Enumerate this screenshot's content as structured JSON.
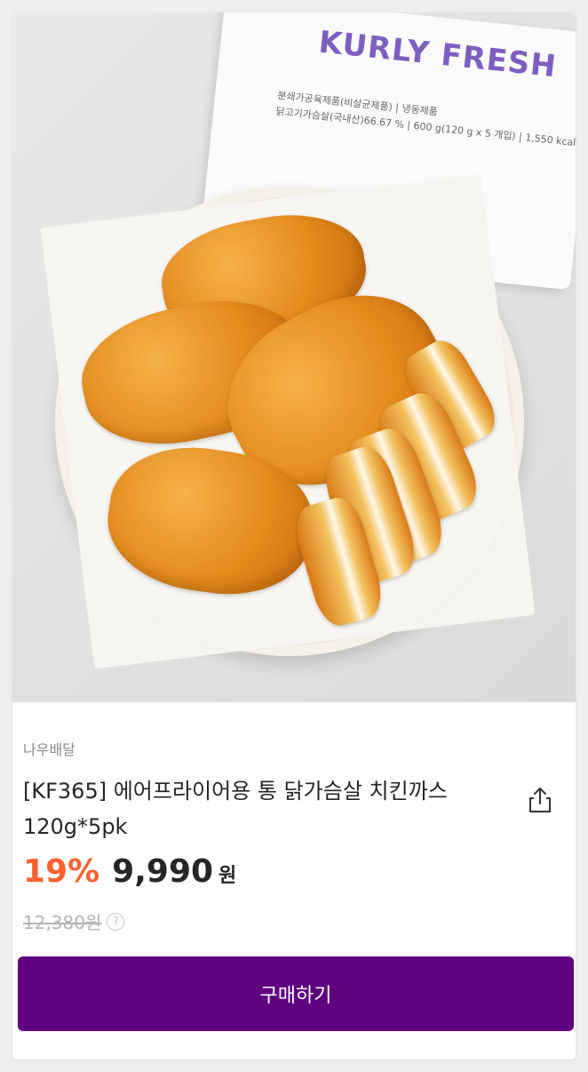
{
  "product": {
    "image": {
      "package_brand": "KURLY FRESH",
      "package_info_line1": "분쇄가공육제품(비살균제품) | 냉동제품",
      "package_info_line2": "닭고기가슴살(국내산)66.67 % | 600 g(120 g x 5 개입) | 1,550 kcal"
    },
    "seller": "나우배달",
    "title": "[KF365] 에어프라이어용 통 닭가슴살 치킨까스 120g*5pk",
    "discount_rate": "19%",
    "price": "9,990",
    "currency": "원",
    "original_price": "12,380원",
    "help_symbol": "?",
    "buy_label": "구매하기"
  },
  "colors": {
    "brand_purple": "#5f0080",
    "discount_orange": "#fa622f",
    "text_dark": "#262626"
  },
  "icons": {
    "share": "share-icon",
    "help": "question-circle-icon"
  }
}
